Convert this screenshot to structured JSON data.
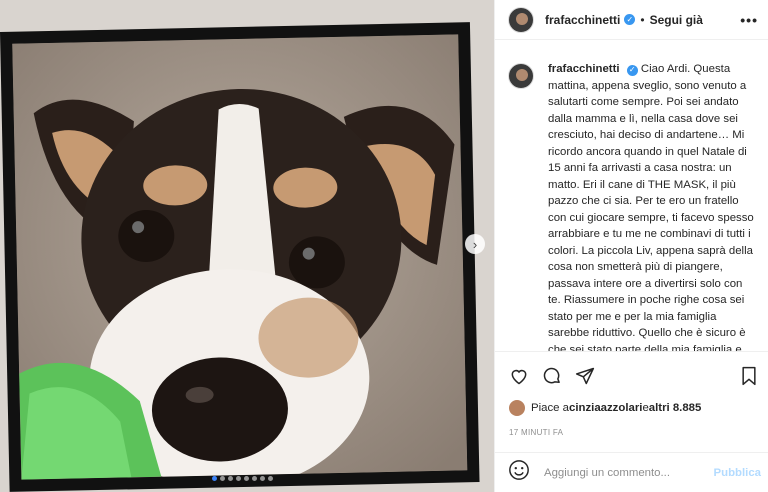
{
  "post": {
    "username": "frafacchinetti",
    "follow_label": "Segui già",
    "more_icon": "more-options-icon",
    "verified_mark": "✓",
    "separator": "•"
  },
  "caption": {
    "username": "frafacchinetti",
    "text": "Ciao Ardi. Questa mattina, appena sveglio, sono venuto a salutarti come sempre. Poi sei andato dalla mamma e lì, nella casa dove sei cresciuto, hai deciso di andartene… Mi ricordo ancora quando in quel Natale di 15 anni fa arrivasti a casa nostra: un matto. Eri il cane di THE MASK, il più pazzo che ci sia. Per te ero un fratello con cui giocare sempre, ti facevo spesso arrabbiare e tu me ne combinavi di tutti i colori. La piccola Liv, appena saprà della cosa non smetterà più di piangere, passava intere ore a divertirsi solo con te. Riassumere in poche righe cosa sei stato per me e per la mia famiglia sarebbe riduttivo. Quello che è sicuro è che sei stato parte della mia famiglia e oggi abbiamo perso una parte di noi."
  },
  "likes": {
    "prefix": "Piace a ",
    "user": "cinziaazzolari",
    "middle": " e ",
    "others": "altri 8.885"
  },
  "timestamp": "17 MINUTI FA",
  "comment": {
    "placeholder": "Aggiungi un commento...",
    "publish_label": "Pubblica"
  },
  "carousel": {
    "next_glyph": "›",
    "total_slides": 8,
    "active_index": 0
  },
  "colors": {
    "verified": "#3897f0",
    "publish_disabled": "#b3dbff",
    "active_dot": "#3b82f6"
  }
}
